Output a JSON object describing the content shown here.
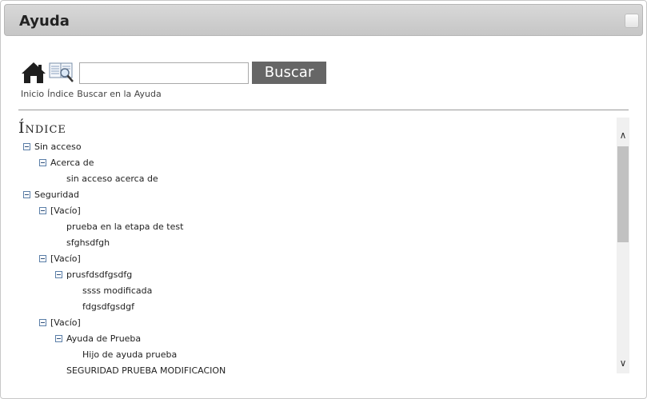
{
  "window": {
    "title": "Ayuda"
  },
  "toolbar": {
    "search_value": "",
    "search_button": "Buscar",
    "icons": [
      "home-icon",
      "index-icon"
    ]
  },
  "links": {
    "home": "Inicio",
    "index": "Índice",
    "search": "Buscar en la Ayuda"
  },
  "index": {
    "heading": "Índice",
    "nodes": [
      {
        "label": "Sin acceso",
        "level": 0,
        "expandable": true
      },
      {
        "label": "Acerca de",
        "level": 1,
        "expandable": true
      },
      {
        "label": "sin acceso acerca de",
        "level": 2,
        "expandable": false
      },
      {
        "label": "Seguridad",
        "level": 0,
        "expandable": true
      },
      {
        "label": "[Vacío]",
        "level": 1,
        "expandable": true
      },
      {
        "label": "prueba en la etapa de test",
        "level": 2,
        "expandable": false
      },
      {
        "label": "sfghsdfgh",
        "level": 2,
        "expandable": false
      },
      {
        "label": "[Vacío]",
        "level": 1,
        "expandable": true
      },
      {
        "label": "prusfdsdfgsdfg",
        "level": 2,
        "expandable": true
      },
      {
        "label": "ssss modificada",
        "level": 3,
        "expandable": false
      },
      {
        "label": "fdgsdfgsdgf",
        "level": 3,
        "expandable": false
      },
      {
        "label": "[Vacío]",
        "level": 1,
        "expandable": true
      },
      {
        "label": "Ayuda de Prueba",
        "level": 2,
        "expandable": true
      },
      {
        "label": "Hijo de ayuda prueba",
        "level": 3,
        "expandable": false
      },
      {
        "label": "SEGURIDAD PRUEBA MODIFICACION",
        "level": 2,
        "expandable": false
      }
    ]
  }
}
